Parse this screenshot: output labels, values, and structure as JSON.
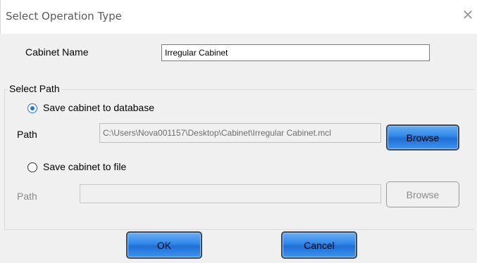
{
  "dialog": {
    "title": "Select Operation Type",
    "close_glyph": "✕"
  },
  "cabinet_name": {
    "label": "Cabinet Name",
    "value": "Irregular Cabinet"
  },
  "select_path": {
    "legend": "Select Path",
    "option_database": {
      "label": "Save cabinet to database",
      "checked": true,
      "path_label": "Path",
      "path_value": "C:\\Users\\Nova001157\\Desktop\\Cabinet\\Irregular Cabinet.mcl",
      "browse_label": "Browse"
    },
    "option_file": {
      "label": "Save cabinet to file",
      "checked": false,
      "path_label": "Path",
      "path_value": "",
      "browse_label": "Browse"
    }
  },
  "footer": {
    "ok_label": "OK",
    "cancel_label": "Cancel"
  },
  "colors": {
    "accent_blue": "#2f86e8",
    "radio_checked": "#1f77d1",
    "dialog_bg": "#f0f0f0"
  }
}
